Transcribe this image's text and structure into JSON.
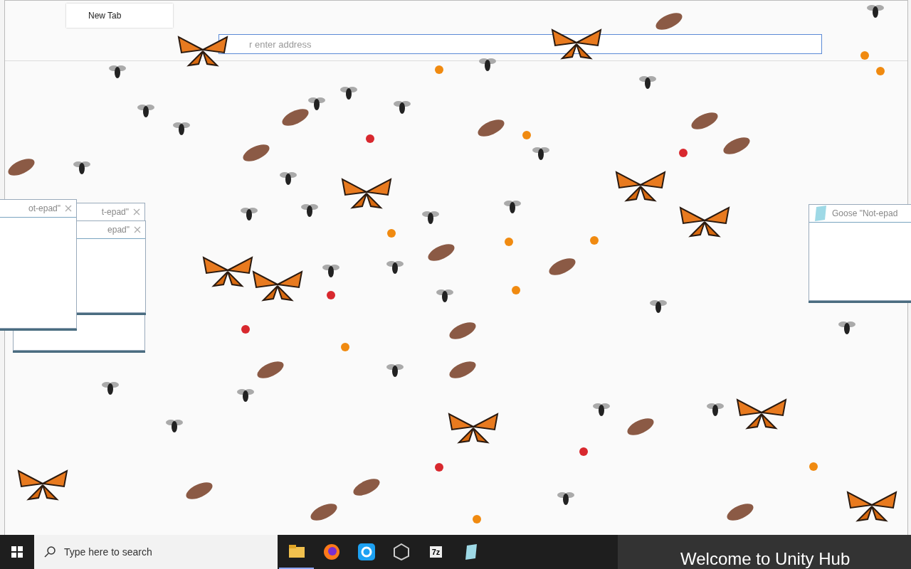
{
  "browser": {
    "tabs": [
      {
        "label": "New Tab",
        "selected": true
      }
    ],
    "address": {
      "placeholder": "r enter address"
    }
  },
  "desktop_windows": [
    {
      "title": "ot-epad\"",
      "kind": "notepad"
    },
    {
      "title": "t-epad\"",
      "kind": "notepad"
    },
    {
      "title": "epad\"",
      "kind": "notepad"
    },
    {
      "title": "Goose \"Not-epad",
      "kind": "goose"
    }
  ],
  "taskbar": {
    "search": {
      "placeholder": "Type here to search"
    },
    "apps": [
      {
        "kind": "folder"
      },
      {
        "kind": "firefox"
      },
      {
        "kind": "sync"
      },
      {
        "kind": "unity"
      },
      {
        "kind": "archive",
        "label": "7z"
      },
      {
        "kind": "notepad"
      }
    ],
    "preview": {
      "title": "Welcome to Unity Hub"
    }
  }
}
